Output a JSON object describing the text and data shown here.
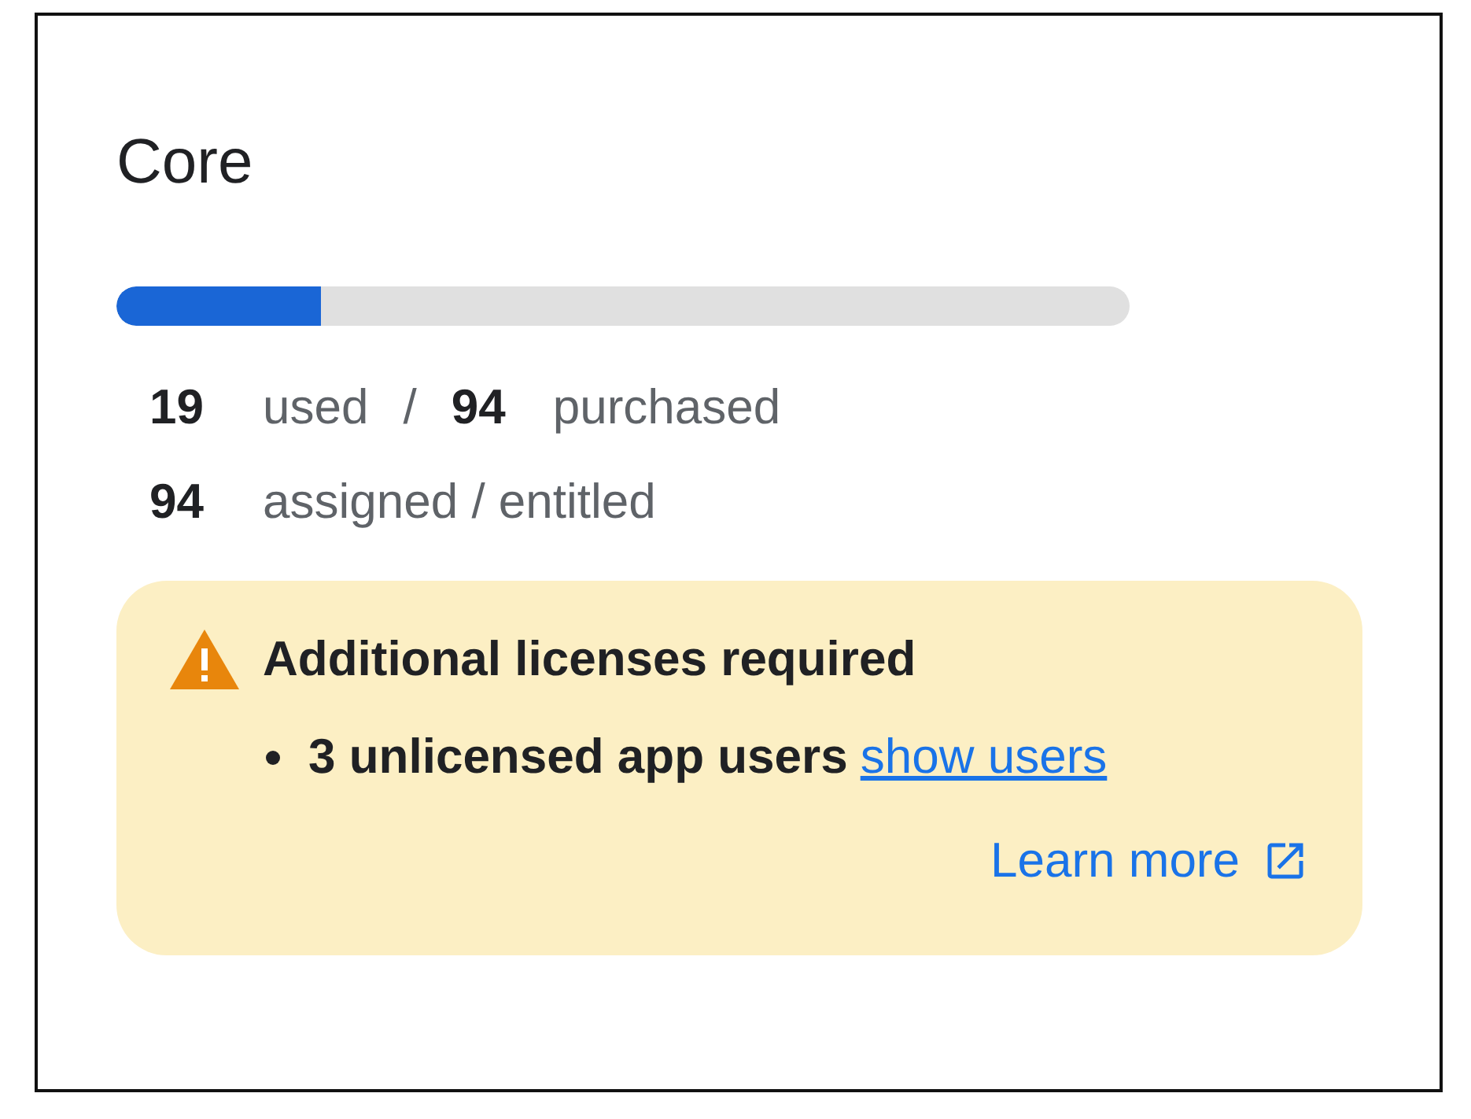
{
  "card": {
    "title": "Core"
  },
  "usage": {
    "level": 0.202
  },
  "stats": [
    {
      "value": "19",
      "label": "used",
      "separator": "/",
      "value_2": "94",
      "label_2": "purchased"
    },
    {
      "value": "94",
      "label": "assigned / entitled"
    }
  ],
  "alert": {
    "title": "Additional licenses required",
    "items": [
      {
        "text": "3 unlicensed app users",
        "link": "show users"
      }
    ],
    "link": "Learn more"
  }
}
